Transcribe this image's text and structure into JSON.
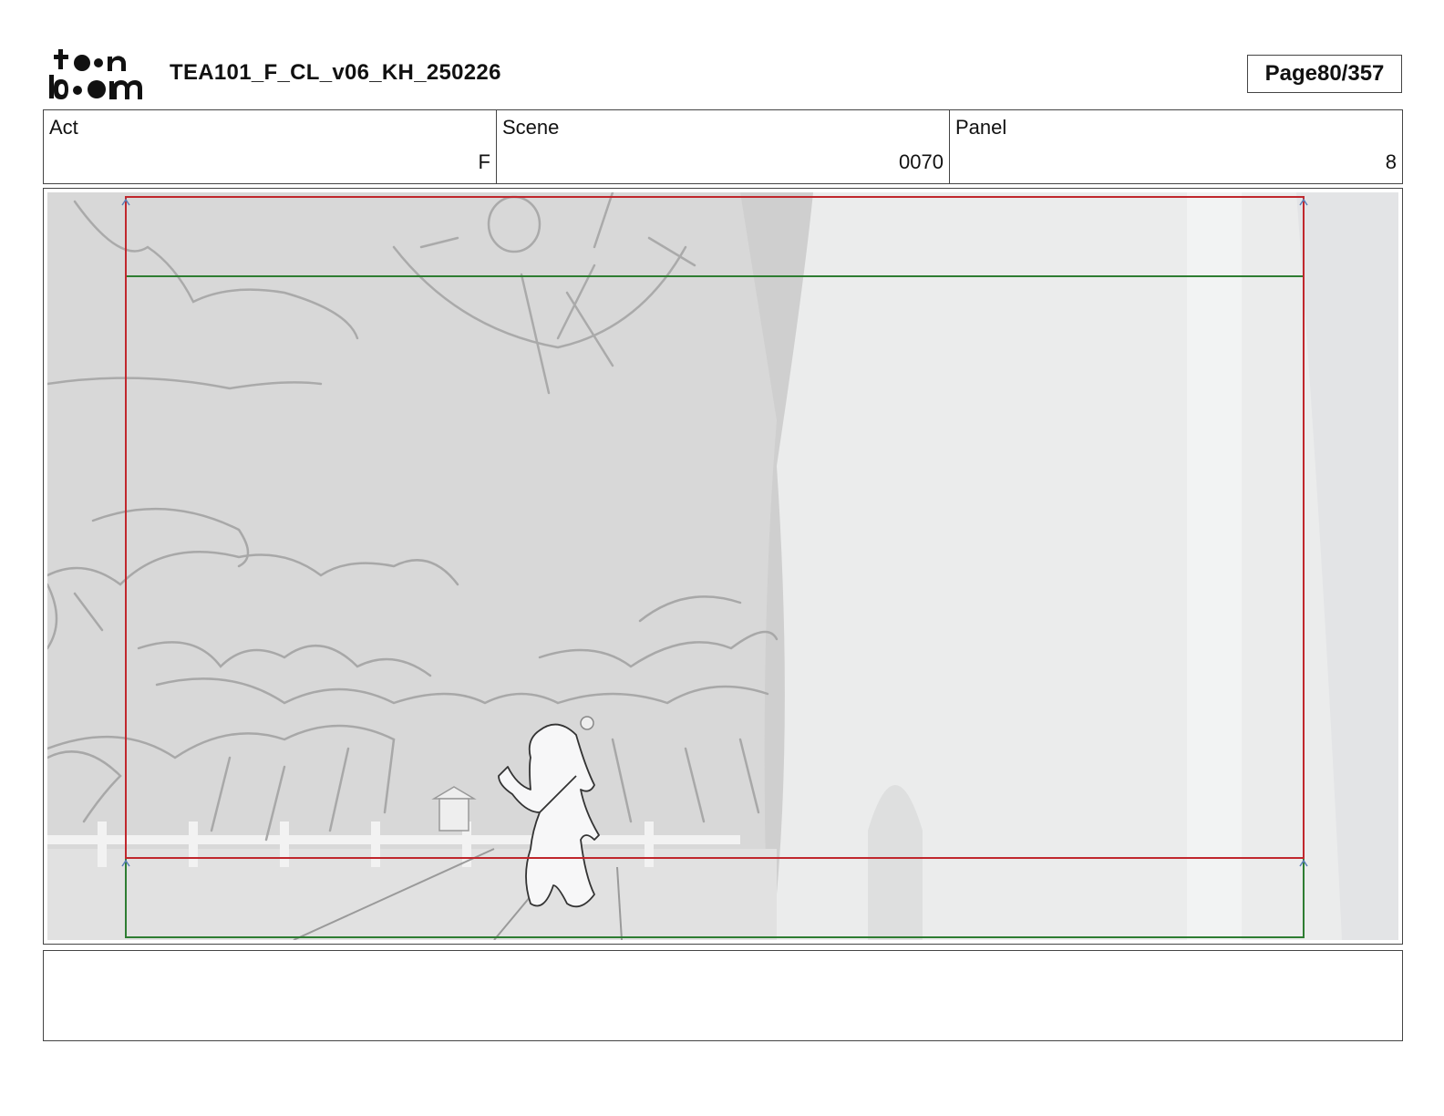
{
  "header": {
    "logo_text": "toon boom",
    "document_title": "TEA101_F_CL_v06_KH_250226",
    "page_label": "Page",
    "page_number": "80/357"
  },
  "info": {
    "act_label": "Act",
    "act_value": "F",
    "scene_label": "Scene",
    "scene_value": "0070",
    "panel_label": "Panel",
    "panel_value": "8"
  },
  "colors": {
    "safe_frame": "#c0272d",
    "camera_frame": "#2e7d32",
    "background": "#d9d9d9",
    "wall": "#eeefef"
  },
  "notes": {
    "text": ""
  }
}
